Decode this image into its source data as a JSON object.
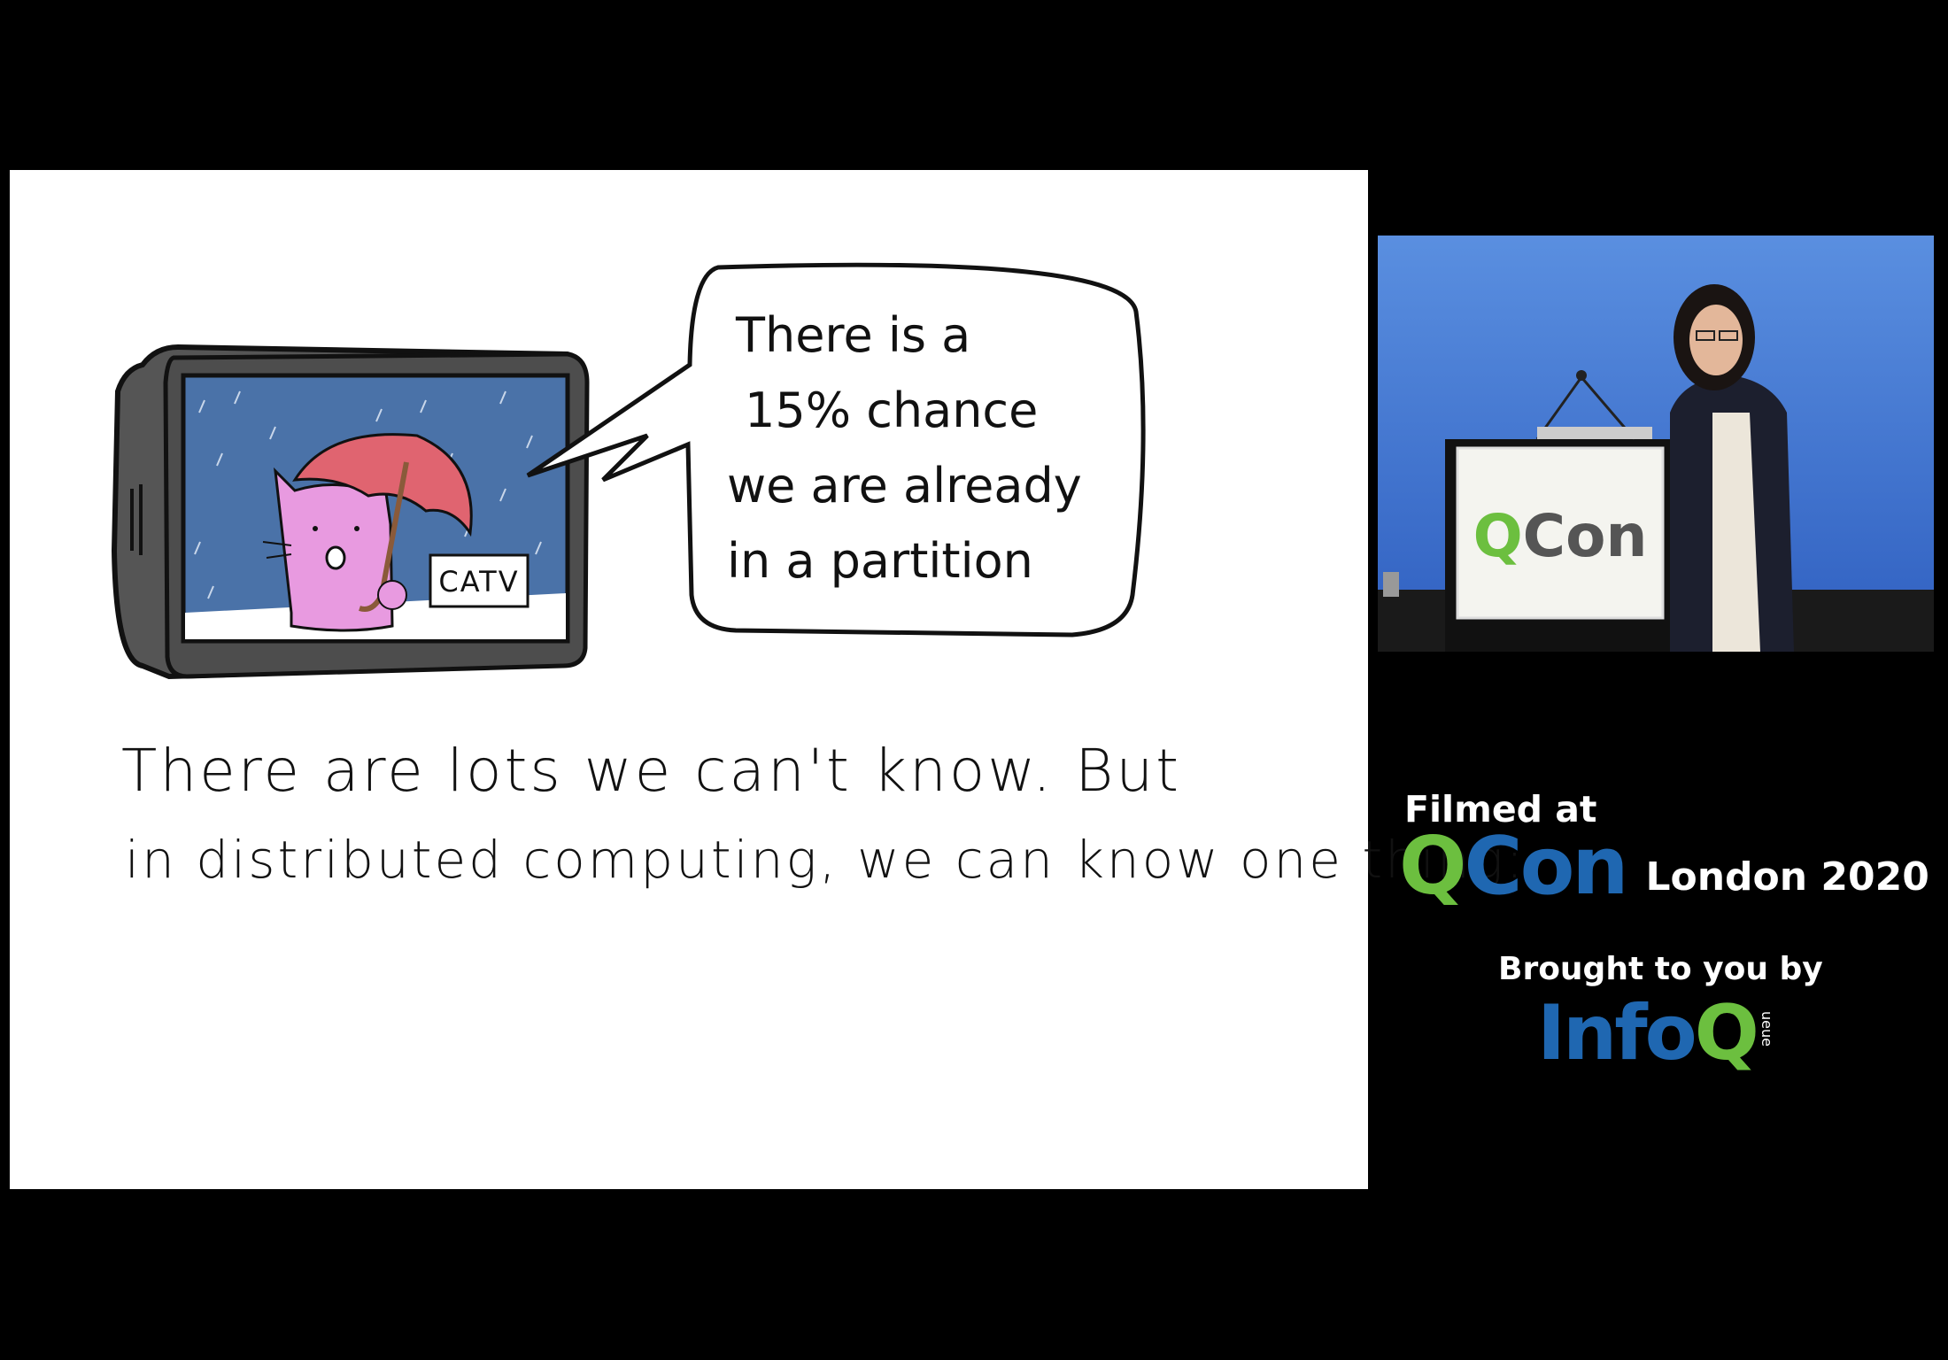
{
  "slide": {
    "bubble_lines": [
      "There is a",
      "15% chance",
      "we are already",
      "in a partition"
    ],
    "tv_label": "CATV",
    "caption_lines": [
      "There are lots we can't know. But",
      "in distributed computing, we can know one thing:"
    ]
  },
  "speaker_video": {
    "podium_logo": "QCon"
  },
  "branding": {
    "filmed_at": "Filmed at",
    "event_logo_q": "Q",
    "event_logo_con": "Con",
    "event_location": "London 2020",
    "brought_by": "Brought to you by",
    "sponsor_logo_info": "Info",
    "sponsor_logo_q": "Q",
    "sponsor_sub": "ueue"
  },
  "colors": {
    "background": "#000000",
    "slide": "#ffffff",
    "qcon_green": "#6cbf3f",
    "qcon_blue": "#1f67b1",
    "tv_body": "#555555",
    "tv_sky": "#4a72a8",
    "cat_pink": "#e89ae0",
    "umbrella_red": "#e06470"
  }
}
